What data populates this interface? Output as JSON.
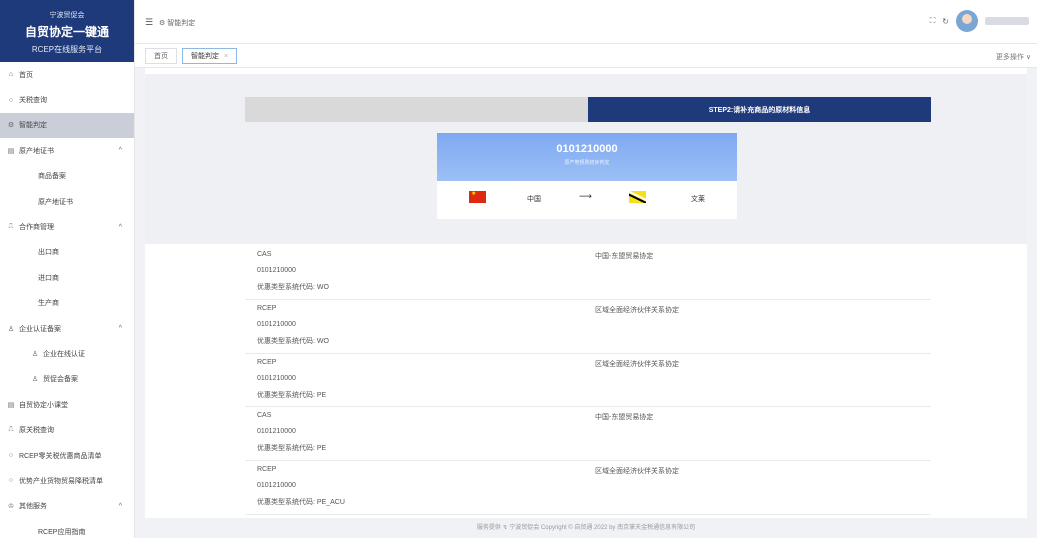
{
  "brand": {
    "org": "宁波贸促会",
    "title": "自贸协定一键通",
    "subtitle": "RCEP在线服务平台"
  },
  "sidebar": {
    "items": [
      {
        "label": "首页",
        "icon": "home-icon",
        "glyph": "⌂",
        "level": 0
      },
      {
        "label": "关税查询",
        "icon": "search-icon",
        "glyph": "○",
        "level": 0
      },
      {
        "label": "智能判定",
        "icon": "gear-icon",
        "glyph": "⚙",
        "level": 0,
        "active": true
      },
      {
        "label": "原产地证书",
        "icon": "certificate-icon",
        "glyph": "▤",
        "level": 0,
        "caret": "^"
      },
      {
        "label": "商品备案",
        "level": 1
      },
      {
        "label": "原产地证书",
        "level": 1
      },
      {
        "label": "合作商管理",
        "icon": "partner-icon",
        "glyph": "⎍",
        "level": 0,
        "caret": "^"
      },
      {
        "label": "出口商",
        "level": 1
      },
      {
        "label": "进口商",
        "level": 1
      },
      {
        "label": "生产商",
        "level": 1
      },
      {
        "label": "企业认证备案",
        "icon": "enterprise-icon",
        "glyph": "♙",
        "level": 0,
        "caret": "^"
      },
      {
        "label": "企业在线认证",
        "icon": "user-icon",
        "glyph": "♙",
        "level": 2
      },
      {
        "label": "贸促会备案",
        "icon": "user-icon",
        "glyph": "♙",
        "level": 2
      },
      {
        "label": "自贸协定小课堂",
        "icon": "book-icon",
        "glyph": "▤",
        "level": 0
      },
      {
        "label": "原关税查询",
        "icon": "tariff-icon",
        "glyph": "⎍",
        "level": 0
      },
      {
        "label": "RCEP零关税优惠商品清单",
        "icon": "search-icon",
        "glyph": "○",
        "level": 0
      },
      {
        "label": "优势产业货物贸易降税清单",
        "icon": "search-icon",
        "glyph": "○",
        "level": 0
      },
      {
        "label": "其他服务",
        "icon": "service-icon",
        "glyph": "♔",
        "level": 0,
        "caret": "^"
      },
      {
        "label": "RCEP应用指南",
        "level": 1
      }
    ]
  },
  "topbar": {
    "breadcrumb": "智能判定",
    "menu_glyph": "☰",
    "crumb_glyph": "⚙",
    "fullscreen_glyph": "⛶",
    "refresh_glyph": "↻"
  },
  "tabs": {
    "home": "首页",
    "current": "智能判定",
    "close": "×",
    "more_ops": "更多操作 ∨"
  },
  "steps": {
    "step1": "",
    "step2": "STEP2:请补充商品的原材料信息"
  },
  "hs_card": {
    "code": "0101210000",
    "subtitle": "原产地规则初步判定",
    "from_country": "中国",
    "to_country": "文莱",
    "arrow": "⟶"
  },
  "results": [
    {
      "rule": "CAS",
      "hs": "0101210000",
      "pref": "优惠类型系统代码: WO",
      "agreement": "中国-东盟贸易协定"
    },
    {
      "rule": "RCEP",
      "hs": "0101210000",
      "pref": "优惠类型系统代码: WO",
      "agreement": "区域全面经济伙伴关系协定"
    },
    {
      "rule": "RCEP",
      "hs": "0101210000",
      "pref": "优惠类型系统代码: PE",
      "agreement": "区域全面经济伙伴关系协定"
    },
    {
      "rule": "CAS",
      "hs": "0101210000",
      "pref": "优惠类型系统代码: PE",
      "agreement": "中国-东盟贸易协定"
    },
    {
      "rule": "RCEP",
      "hs": "0101210000",
      "pref": "优惠类型系统代码: PE_ACU",
      "agreement": "区域全面经济伙伴关系协定"
    }
  ],
  "footer": {
    "text": "服务提供 ↯ 宁波贸促会 Copyright © 自贸通 2022 by 南京掌天金税通信息有限公司"
  }
}
